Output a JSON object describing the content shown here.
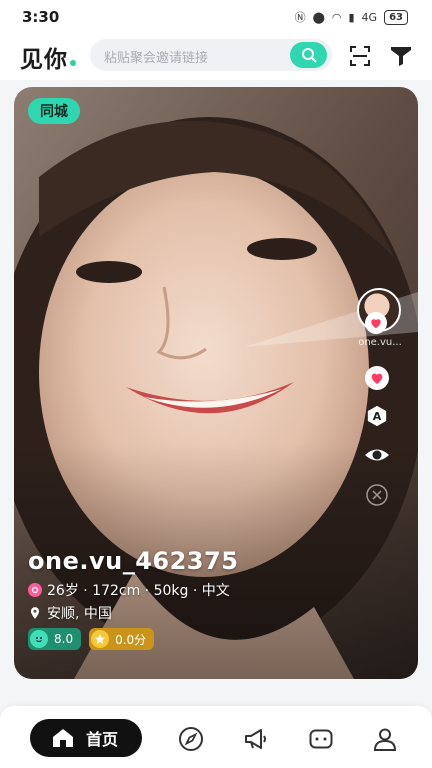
{
  "status_bar": {
    "time": "3:30",
    "signal_label": "4G",
    "battery": "63"
  },
  "header": {
    "logo": "见你",
    "search_placeholder": "粘贴聚会邀请链接",
    "icons": [
      "search-icon",
      "scan-icon",
      "filter-icon"
    ]
  },
  "card": {
    "tag": "同城",
    "nickname": "one.vu_462375",
    "basic_info": "26岁 · 172cm · 50kg · 中文",
    "location": "安顺, 中国",
    "score_green": "8.0",
    "score_gold": "0.0分",
    "side_name": "one.vu...",
    "side_icons": [
      "heart-icon",
      "translate-icon",
      "eye-icon",
      "close-icon"
    ]
  },
  "nav": {
    "home_label": "首页",
    "items": [
      "home-icon",
      "compass-icon",
      "megaphone-icon",
      "message-icon",
      "profile-icon"
    ]
  },
  "colors": {
    "accent": "#2fd7b0",
    "heart": "#ff3b63",
    "gold": "#c99418"
  }
}
